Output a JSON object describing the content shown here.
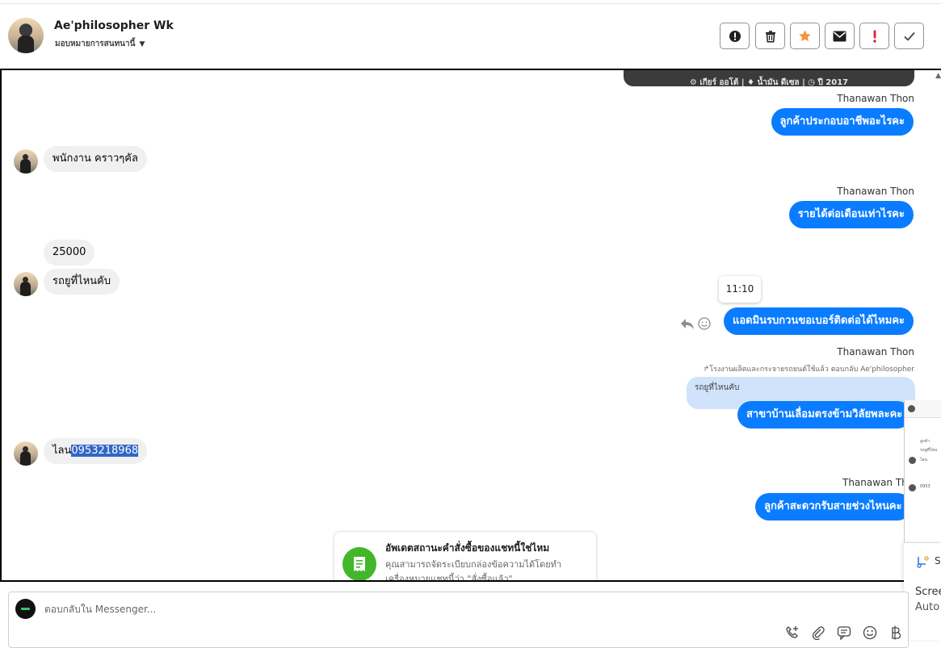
{
  "header": {
    "name": "Ae'philosopher Wk",
    "assign_label": "มอบหมายการสนทนานี้",
    "actions": [
      {
        "icon": "alert-circle-icon"
      },
      {
        "icon": "trash-icon"
      },
      {
        "icon": "star-icon",
        "color": "#f7923b"
      },
      {
        "icon": "envelope-icon"
      },
      {
        "icon": "exclamation-icon",
        "color": "#e41e3f"
      },
      {
        "icon": "checkmark-icon"
      }
    ]
  },
  "banner": {
    "text": "⚙ เกียร์ ออโต้   |   ♦ น้ำมัน ดีเซล   |   ◷ ปี 2017"
  },
  "conversation": {
    "agent_name": "Thanawan Thon",
    "messages": [
      {
        "dir": "out",
        "sender": "Thanawan Thon",
        "text": "ลูกค้าประกอบอาชีพอะไรคะ"
      },
      {
        "dir": "in",
        "text": "พนักงาน  คราวๆคัล"
      },
      {
        "dir": "out",
        "sender": "Thanawan Thon",
        "text": "รายได้ต่อเดือนเท่าไรคะ"
      },
      {
        "dir": "in",
        "text": "25000"
      },
      {
        "dir": "in",
        "text": "รถยูที่ไหนคับ"
      },
      {
        "dir": "out",
        "text": "แอดมินรบกวนขอเบอร์ติดต่อได้ไหมคะ",
        "time": "11:10"
      },
      {
        "dir": "out",
        "sender": "Thanawan Thon",
        "reply_note": "↱โรงงานผลิตและกระจายรถยนต์ใช้แล้ว ตอบกลับ Ae'philosopher",
        "quote": "รถยูที่ไหนคับ",
        "text": "สาขาบ้านเลื่อมตรงข้ามวิลัยพละคะ"
      },
      {
        "dir": "in",
        "text_prefix": "ไลน",
        "text_selected": "0953218968"
      },
      {
        "dir": "out",
        "sender": "Thanawan Thon",
        "text": "ลูกค้าสะดวกรับสายช่วงไหนคะ"
      }
    ]
  },
  "order_card": {
    "title": "อัพเดตสถานะคำสั่งซื้อของแชทนี้ใช่ไหม",
    "description": "คุณสามารถจัดระเบียบกล่องข้อความได้โดยทำเครื่องหมายแชทนี้ว่า \"สั่งซื้อแล้ว\""
  },
  "side_panel": {
    "mini_lines": [
      "ลูกค้า",
      "รถยูที่ไหน",
      "ไลน",
      "0953"
    ],
    "label_s": "S",
    "text_1": "Scree",
    "text_2": "Auto"
  },
  "composer": {
    "placeholder": "ตอบกลับใน Messenger...",
    "tools": [
      "phone-add-icon",
      "paperclip-icon",
      "chat-icon",
      "emoji-icon",
      "baht-icon"
    ]
  },
  "colors": {
    "outgoing_bubble": "#0a7cff",
    "incoming_bubble": "#f0f0f0",
    "selection": "#3166c7",
    "card_icon": "#42b72a"
  }
}
